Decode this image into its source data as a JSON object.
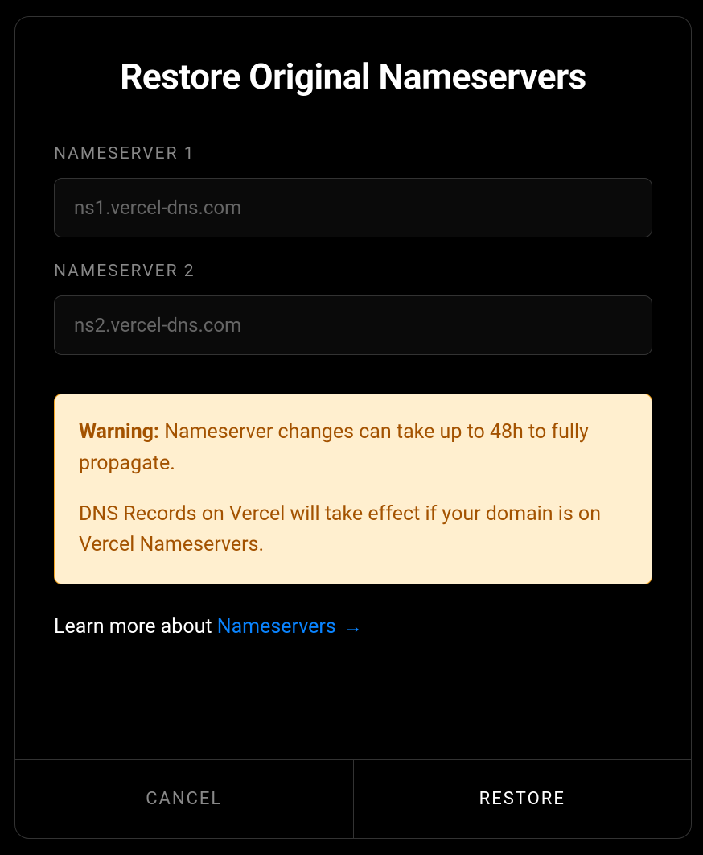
{
  "modal": {
    "title": "Restore Original Nameservers",
    "fields": [
      {
        "label": "NAMESERVER 1",
        "placeholder": "ns1.vercel-dns.com",
        "value": ""
      },
      {
        "label": "NAMESERVER 2",
        "placeholder": "ns2.vercel-dns.com",
        "value": ""
      }
    ],
    "warning": {
      "label": "Warning:",
      "line1": "Nameserver changes can take up to 48h to fully propagate.",
      "line2": "DNS Records on Vercel will take effect if your domain is on Vercel Nameservers."
    },
    "learn_more": {
      "prefix": "Learn more about ",
      "link_text": "Nameservers",
      "arrow": "→"
    },
    "footer": {
      "cancel": "CANCEL",
      "restore": "RESTORE"
    }
  }
}
